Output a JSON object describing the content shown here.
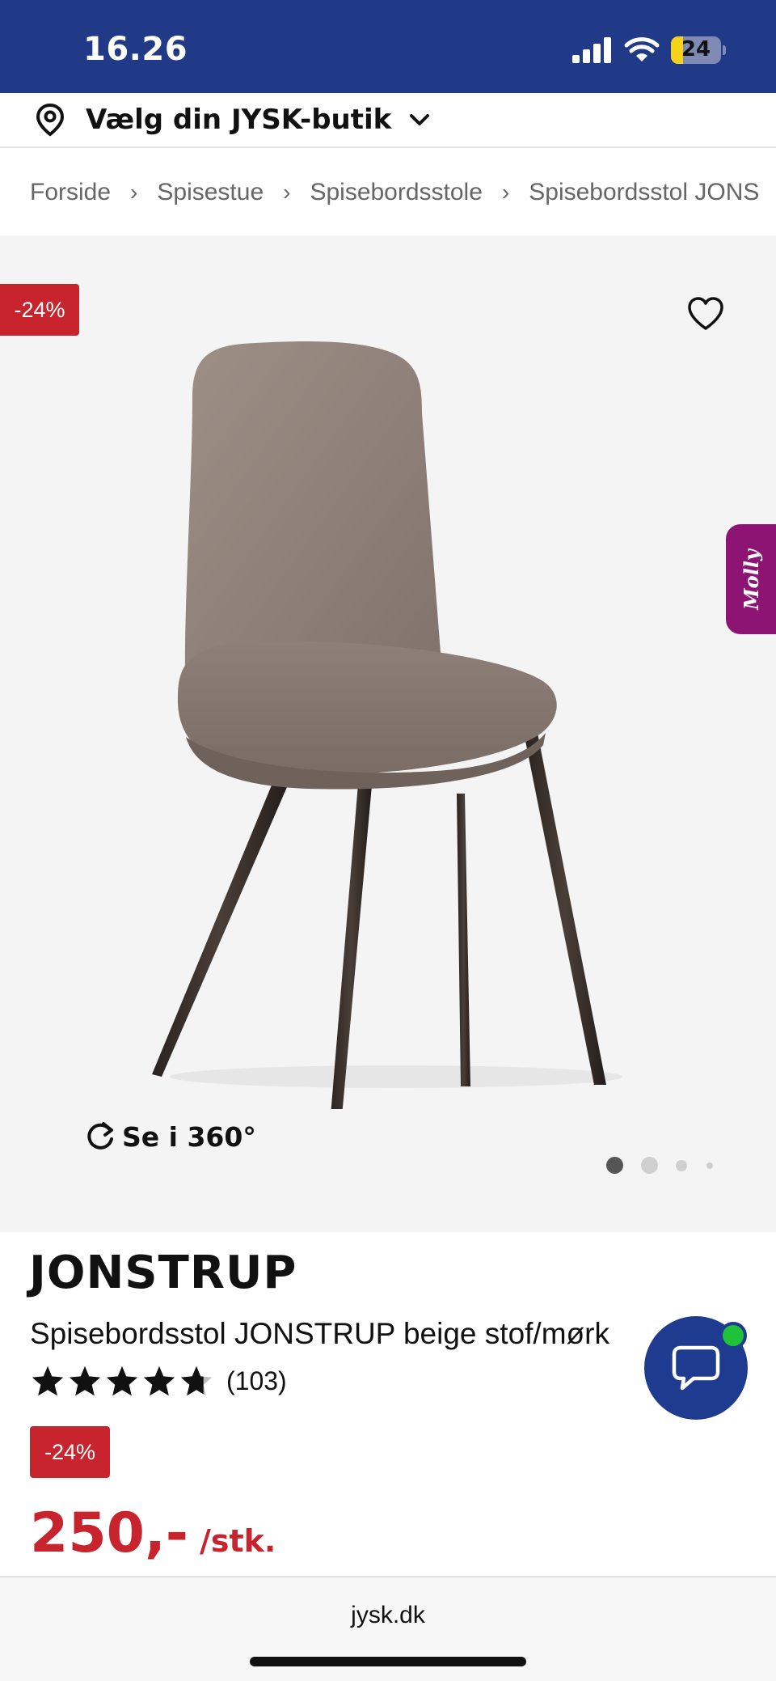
{
  "status_bar": {
    "time": "16.26",
    "battery": "24",
    "battery_level_percent": 24,
    "icons": [
      "signal-icon",
      "wifi-icon",
      "battery-icon"
    ]
  },
  "store_selector": {
    "label": "Vælg din JYSK-butik",
    "icon": "location-pin-icon"
  },
  "breadcrumb": [
    "Forside",
    "Spisestue",
    "Spisebordsstole",
    "Spisebordsstol JONS"
  ],
  "gallery": {
    "discount": "-24%",
    "view_360": "Se i 360°",
    "molly_tab": "Molly",
    "dots_total": 4,
    "active_dot": 0
  },
  "product": {
    "brand": "JONSTRUP",
    "name": "Spisebordsstol JONSTRUP beige stof/mørk",
    "rating_stars": 4.7,
    "rating_count": "(103)",
    "discount": "-24%",
    "price": "250,-",
    "unit": "/stk."
  },
  "browser": {
    "url": "jysk.dk"
  },
  "colors": {
    "brand_blue": "#213a87",
    "sale_red": "#c8242d",
    "molly_purple": "#8e1474",
    "online_green": "#1fc23a"
  }
}
